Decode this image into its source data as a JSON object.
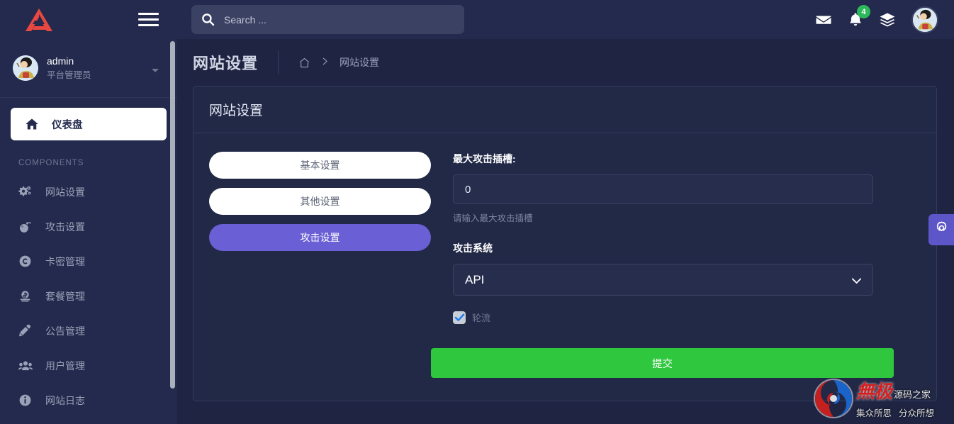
{
  "sidebar": {
    "logo_icon": "triangle-a-logo",
    "logo_color": "#e8483f",
    "menu_toggle_icon": "hamburger-icon",
    "user": {
      "name": "admin",
      "role": "平台管理员",
      "avatar_icon": "user-avatar",
      "caret_icon": "caret-down-icon"
    },
    "active_item": {
      "label": "仪表盘",
      "icon": "home-icon"
    },
    "heading": "COMPONENTS",
    "items": [
      {
        "label": "网站设置",
        "icon": "cogs-icon"
      },
      {
        "label": "攻击设置",
        "icon": "bomb-icon"
      },
      {
        "label": "卡密管理",
        "icon": "copyright-circle-icon"
      },
      {
        "label": "套餐管理",
        "icon": "money-bill-icon"
      },
      {
        "label": "公告管理",
        "icon": "pen-icon"
      },
      {
        "label": "用户管理",
        "icon": "users-icon"
      },
      {
        "label": "网站日志",
        "icon": "info-circle-icon"
      }
    ]
  },
  "topbar": {
    "search": {
      "placeholder": "Search ...",
      "value": "",
      "icon": "search-icon"
    },
    "mail_icon": "envelope-icon",
    "bell_icon": "bell-icon",
    "notification_count": "4",
    "notification_color": "#2eb85c",
    "layers_icon": "layers-icon",
    "avatar_icon": "user-avatar"
  },
  "page": {
    "title": "网站设置",
    "breadcrumb": {
      "home_icon": "home-outline-icon",
      "separator": "〉",
      "current": "网站设置"
    }
  },
  "card": {
    "title": "网站设置",
    "tabs": [
      {
        "label": "基本设置",
        "active": false
      },
      {
        "label": "其他设置",
        "active": false
      },
      {
        "label": "攻击设置",
        "active": true
      }
    ],
    "active_tab_color": "#6a5fd4",
    "form": {
      "slot_label": "最大攻击插槽:",
      "slot_value": "0",
      "slot_placeholder": "请输入最大攻击插槽",
      "slot_help": "请输入最大攻击插槽",
      "system_label": "攻击系统",
      "system_value": "API",
      "system_options": [
        "API"
      ],
      "system_chevron_icon": "chevron-down-icon",
      "checkbox_label": "轮流",
      "checkbox_checked": true,
      "submit_label": "提交",
      "submit_color": "#2ec73d"
    }
  },
  "settings_tab": {
    "icon": "gear-icon",
    "color": "#5d56c9"
  },
  "watermark": {
    "logo_icon": "swirl-logo",
    "brand": "無极",
    "brand_suffix": "源码之家",
    "tagline_left": "集众所思",
    "tagline_right": "分众所想"
  }
}
